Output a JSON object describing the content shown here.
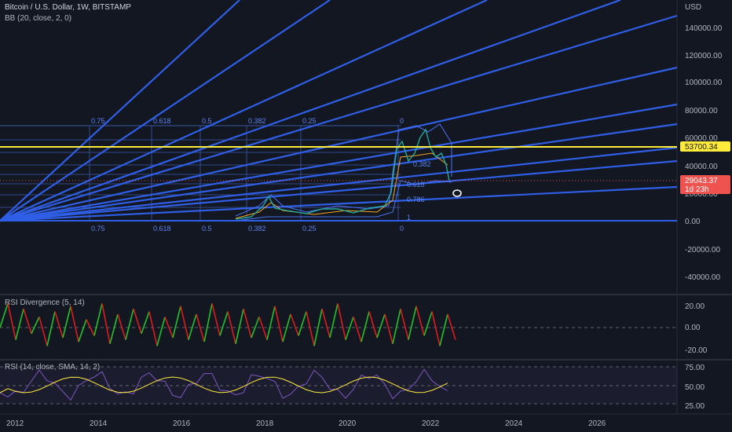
{
  "header": {
    "title": "Bitcoin / U.S. Dollar, 1W, BITSTAMP",
    "indicator": "BB (20, close, 2, 0)"
  },
  "price_axis": {
    "currency": "USD",
    "ticks": [
      "140000.00",
      "120000.00",
      "100000.00",
      "80000.00",
      "60000.00",
      "40000.00",
      "20000.00",
      "0.00",
      "-20000.00",
      "-40000.00"
    ],
    "level_label": "53700.34",
    "last_price": "29043.37",
    "countdown": "1d 23h"
  },
  "fib_labels": {
    "upper": [
      "0.75",
      "0.618",
      "0.5",
      "0.382",
      "0.25",
      "0"
    ],
    "lower": [
      "0.75",
      "0.618",
      "0.5",
      "0.382",
      "0.25",
      "0"
    ],
    "right": [
      "0.382",
      "0.618",
      "0.786",
      "1"
    ]
  },
  "rsi_divergence": {
    "title": "RSI Divergence (5, 14)",
    "ticks": [
      "20.00",
      "0.00",
      "-20.00"
    ]
  },
  "rsi": {
    "title": "RSI (14, close, SMA, 14, 2)",
    "ticks": [
      "75.00",
      "50.00",
      "25.00"
    ]
  },
  "time_axis": {
    "ticks": [
      "2012",
      "2014",
      "2016",
      "2018",
      "2020",
      "2022",
      "2024",
      "2026"
    ]
  },
  "colors": {
    "background": "#131722",
    "fan": "#2f5fe6",
    "level": "#ffeb3b",
    "price_tag": "#ef5350",
    "divergence_up": "#22c32a",
    "divergence_down": "#e01b1b",
    "rsi_line": "#7e57c2",
    "rsi_ma": "#ffeb3b"
  }
}
